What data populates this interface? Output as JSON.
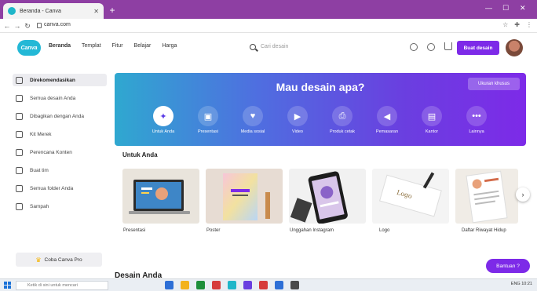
{
  "browser": {
    "tab_title": "Beranda - Canva",
    "url": "canva.com",
    "new_tab": "+"
  },
  "header": {
    "logo": "Canva",
    "menu": [
      "Beranda",
      "Templat",
      "Fitur",
      "Belajar",
      "Harga"
    ],
    "search_placeholder": "Cari desain",
    "create_label": "Buat desain"
  },
  "sidebar": {
    "items": [
      {
        "label": "Direkomendasikan",
        "icon": "home-icon"
      },
      {
        "label": "Semua desain Anda",
        "icon": "grid-icon"
      },
      {
        "label": "Dibagikan dengan Anda",
        "icon": "users-icon"
      },
      {
        "label": "Kit Merek",
        "icon": "brand-icon"
      },
      {
        "label": "Perencana Konten",
        "icon": "calendar-icon"
      },
      {
        "label": "Buat tim",
        "icon": "team-icon"
      },
      {
        "label": "Semua folder Anda",
        "icon": "folder-icon"
      },
      {
        "label": "Sampah",
        "icon": "trash-icon"
      }
    ],
    "pro_label": "Coba Canva Pro"
  },
  "hero": {
    "title": "Mau desain apa?",
    "upload_label": "Ukuran khusus",
    "categories": [
      {
        "label": "Untuk Anda",
        "glyph": "✦",
        "icon": "sparkle-icon"
      },
      {
        "label": "Presentasi",
        "glyph": "▣",
        "icon": "presentation-icon"
      },
      {
        "label": "Media sosial",
        "glyph": "♥",
        "icon": "social-icon"
      },
      {
        "label": "Video",
        "glyph": "▶",
        "icon": "video-icon"
      },
      {
        "label": "Produk cetak",
        "glyph": "⎙",
        "icon": "print-icon"
      },
      {
        "label": "Pemasaran",
        "glyph": "◀",
        "icon": "marketing-icon"
      },
      {
        "label": "Kantor",
        "glyph": "▤",
        "icon": "office-icon"
      },
      {
        "label": "Lainnya",
        "glyph": "•••",
        "icon": "more-icon"
      }
    ]
  },
  "for_you": {
    "title": "Untuk Anda",
    "cards": [
      {
        "label": "Presentasi"
      },
      {
        "label": "Poster"
      },
      {
        "label": "Unggahan Instagram"
      },
      {
        "label": "Logo"
      },
      {
        "label": "Daftar Riwayat Hidup"
      }
    ]
  },
  "designs_title": "Desain Anda",
  "help_label": "Bantuan ?",
  "taskbar": {
    "search_placeholder": "Ketik di sini untuk mencari",
    "tray_text": "ENG  10:21",
    "app_colors": [
      "#2e6fd6",
      "#f3b21a",
      "#1f8f3a",
      "#d63b3b",
      "#1fb6c9",
      "#6a3fe0",
      "#d63b3b",
      "#2e6fd6",
      "#4a4a4a"
    ]
  },
  "colors": {
    "accent": "#7d2ae8",
    "tab_strip": "#8e3fa3",
    "logo": "#23b8d6"
  }
}
